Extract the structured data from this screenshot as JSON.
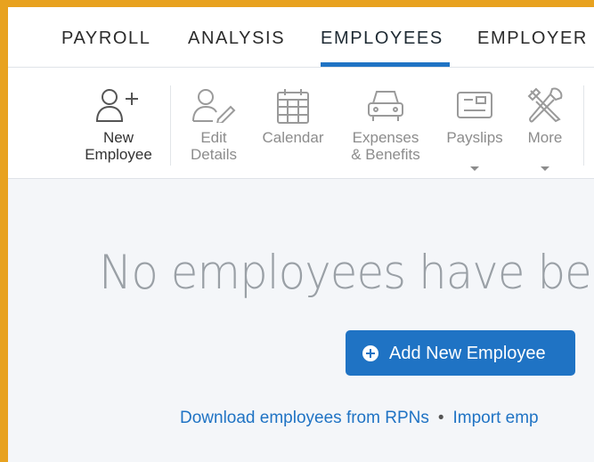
{
  "nav": {
    "tabs": [
      {
        "label": "PAYROLL"
      },
      {
        "label": "ANALYSIS"
      },
      {
        "label": "EMPLOYEES",
        "active": true
      },
      {
        "label": "EMPLOYER"
      }
    ]
  },
  "toolbar": {
    "new_employee": {
      "line1": "New",
      "line2": "Employee",
      "icon": "person-add-icon"
    },
    "edit_details": {
      "line1": "Edit",
      "line2": "Details",
      "icon": "person-edit-icon"
    },
    "calendar": {
      "label": "Calendar",
      "icon": "calendar-icon"
    },
    "expenses": {
      "line1": "Expenses",
      "line2": "& Benefits",
      "icon": "car-icon"
    },
    "payslips": {
      "label": "Payslips",
      "icon": "payslip-icon"
    },
    "more": {
      "label": "More",
      "icon": "tools-icon"
    }
  },
  "empty_state": {
    "title": "No employees have be",
    "add_button": "Add New Employee",
    "download_link": "Download employees from RPNs",
    "separator": "•",
    "import_link": "Import emp"
  },
  "colors": {
    "accent": "#1f73c4",
    "frame": "#e8a21f",
    "background": "#f4f6f9"
  }
}
